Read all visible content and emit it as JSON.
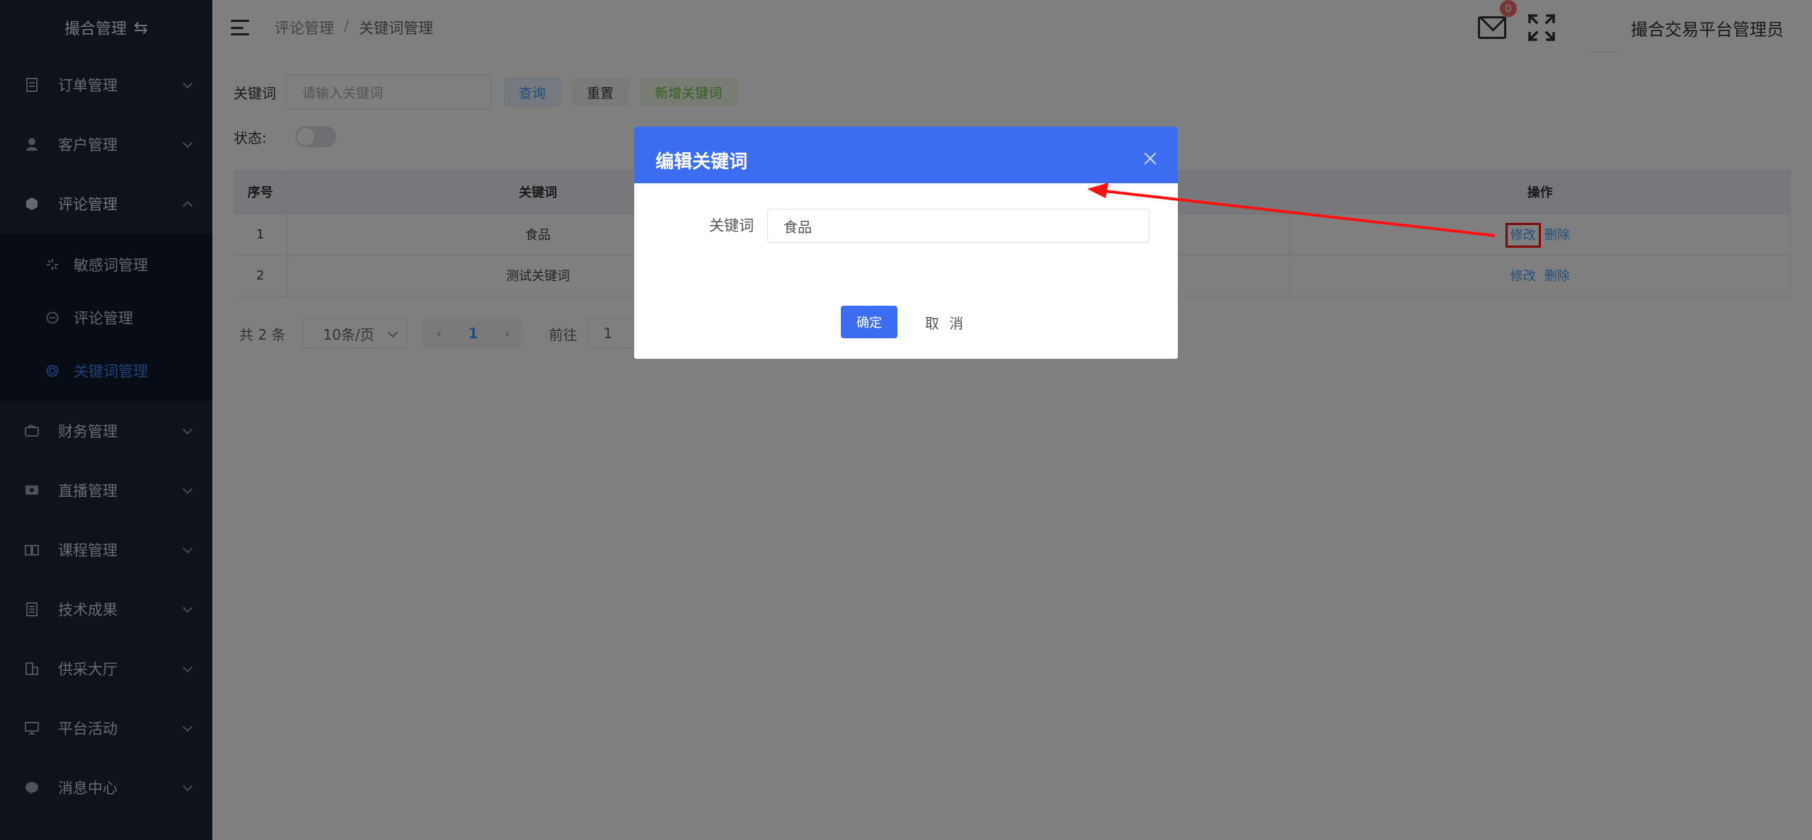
{
  "brand": {
    "title": "撮合管理",
    "swap_icon": "⇆"
  },
  "sidebar": {
    "items": [
      {
        "label": "订单管理",
        "icon": "document-icon",
        "expanded": false
      },
      {
        "label": "客户管理",
        "icon": "user-icon",
        "expanded": false
      },
      {
        "label": "评论管理",
        "icon": "comment-group-icon",
        "expanded": true
      },
      {
        "label": "财务管理",
        "icon": "wallet-icon",
        "expanded": false
      },
      {
        "label": "直播管理",
        "icon": "live-icon",
        "expanded": false
      },
      {
        "label": "课程管理",
        "icon": "book-icon",
        "expanded": false
      },
      {
        "label": "技术成果",
        "icon": "report-icon",
        "expanded": false
      },
      {
        "label": "供采大厅",
        "icon": "building-icon",
        "expanded": false
      },
      {
        "label": "平台活动",
        "icon": "monitor-icon",
        "expanded": false
      },
      {
        "label": "消息中心",
        "icon": "message-icon",
        "expanded": false
      }
    ],
    "submenu": [
      {
        "label": "敏感词管理",
        "icon": "sparkle-icon",
        "active": false
      },
      {
        "label": "评论管理",
        "icon": "chat-bubble-icon",
        "active": false
      },
      {
        "label": "关键词管理",
        "icon": "target-icon",
        "active": true
      }
    ]
  },
  "header": {
    "breadcrumb": [
      "评论管理",
      "关键词管理"
    ],
    "separator": "/",
    "mail_badge": "0",
    "username": "撮合交易平台管理员"
  },
  "search": {
    "label": "关键词",
    "placeholder": "请输入关键词",
    "query_label": "查询",
    "reset_label": "重置",
    "add_label": "新增关键词",
    "status_label": "状态:"
  },
  "table": {
    "headers": {
      "index": "序号",
      "keyword": "关键词",
      "actions": "操作"
    },
    "rows": [
      {
        "index": "1",
        "keyword": "食品",
        "edit": "修改",
        "delete": "删除"
      },
      {
        "index": "2",
        "keyword": "测试关键词",
        "edit": "修改",
        "delete": "删除"
      }
    ]
  },
  "pager": {
    "total": "共 2 条",
    "page_size": "10条/页",
    "current_page": "1",
    "goto_label": "前往",
    "goto_value": "1"
  },
  "dialog": {
    "title": "编辑关键词",
    "field_label": "关键词",
    "field_value": "食品",
    "ok_label": "确定",
    "cancel_label": "取 消"
  },
  "colors": {
    "sidebar_bg": "#1d2637",
    "submenu_bg": "#111a2b",
    "active": "#3a86ff",
    "dialog_header": "#3c6df0",
    "annotation": "#f11"
  }
}
